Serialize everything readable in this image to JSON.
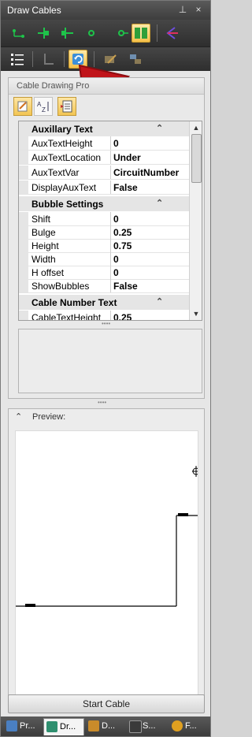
{
  "window": {
    "title": "Draw Cables"
  },
  "titlebar": {
    "pin_glyph": "⊥",
    "close_glyph": "×"
  },
  "toolbar1": {
    "tools": [
      "green-points-icon",
      "green-tee-left-icon",
      "green-tee-right-icon",
      "green-dot-icon",
      "green-dot-line-icon",
      "book-icon",
      "cable-arrow-icon"
    ]
  },
  "toolbar2": {
    "tools": [
      "list-view-icon",
      "disabled-icon",
      "refresh-icon",
      "edit-disabled-icon",
      "swap-disabled-icon"
    ]
  },
  "group": {
    "title": "Cable Drawing Pro",
    "tools": [
      "edit-icon",
      "az-sort-icon",
      "property-pages-icon"
    ]
  },
  "property_grid": {
    "categories": [
      {
        "name": "Auxillary Text",
        "collapse_glyph": "⌃",
        "rows": [
          {
            "name": "AuxTextHeight",
            "value": "0"
          },
          {
            "name": "AuxTextLocation",
            "value": "Under"
          },
          {
            "name": "AuxTextVar",
            "value": "CircuitNumber"
          },
          {
            "name": "DisplayAuxText",
            "value": "False"
          }
        ]
      },
      {
        "name": "Bubble Settings",
        "collapse_glyph": "⌃",
        "rows": [
          {
            "name": "Shift",
            "value": "0"
          },
          {
            "name": "Bulge",
            "value": "0.25"
          },
          {
            "name": "Height",
            "value": "0.75"
          },
          {
            "name": "Width",
            "value": "0"
          },
          {
            "name": "H offset",
            "value": "0"
          },
          {
            "name": "ShowBubbles",
            "value": "False"
          }
        ]
      },
      {
        "name": "Cable Number Text",
        "collapse_glyph": "⌃",
        "rows": [
          {
            "name": "CableTextHeight",
            "value": "0.25"
          }
        ]
      }
    ],
    "scroll_up": "▲",
    "scroll_down": "▼"
  },
  "splitter": {
    "grip": "••••"
  },
  "preview": {
    "label": "Preview:",
    "collapse_glyph": "⌃"
  },
  "start_button": {
    "label": "Start Cable"
  },
  "bottom_tabs": [
    {
      "label": "Pr...",
      "icon": "project-icon",
      "color": "#4a7fc1"
    },
    {
      "label": "Dr...",
      "icon": "draw-cable-icon",
      "color": "#2f8f6f"
    },
    {
      "label": "D...",
      "icon": "device-icon",
      "color": "#c98b2a"
    },
    {
      "label": "S...",
      "icon": "symbols-icon",
      "color": "#3a3a3a"
    },
    {
      "label": "F...",
      "icon": "footprint-icon",
      "color": "#e0a020"
    }
  ],
  "colors": {
    "accent_arrow": "#c0141a",
    "tool_green": "#1ec44a",
    "active_tool": "#f5c04a"
  }
}
